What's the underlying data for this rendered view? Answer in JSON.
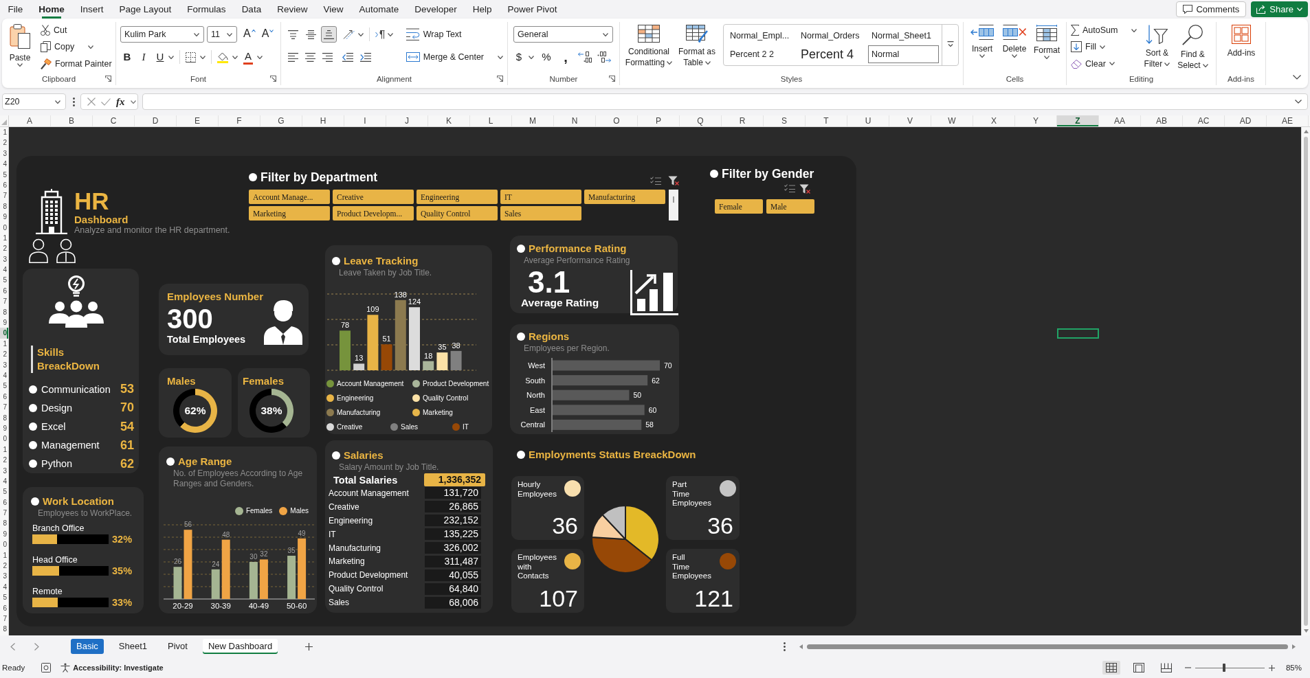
{
  "menu_tabs": [
    {
      "label": "File",
      "selected": false
    },
    {
      "label": "Home",
      "selected": true
    },
    {
      "label": "Insert",
      "selected": false
    },
    {
      "label": "Page Layout",
      "selected": false
    },
    {
      "label": "Formulas",
      "selected": false
    },
    {
      "label": "Data",
      "selected": false
    },
    {
      "label": "Review",
      "selected": false
    },
    {
      "label": "View",
      "selected": false
    },
    {
      "label": "Automate",
      "selected": false
    },
    {
      "label": "Developer",
      "selected": false
    },
    {
      "label": "Help",
      "selected": false
    },
    {
      "label": "Power Pivot",
      "selected": false
    }
  ],
  "comments_button": "Comments",
  "share_button": "Share",
  "ribbon": {
    "clipboard": {
      "label": "Clipboard",
      "paste": "Paste",
      "cut": "Cut",
      "copy": "Copy",
      "format_painter": "Format Painter"
    },
    "font": {
      "label": "Font",
      "font_name": "Kulim Park",
      "font_size": "11",
      "grow_font": "A",
      "shrink_font": "A",
      "bold": "B",
      "italic": "I",
      "underline": "U",
      "font_color": "A"
    },
    "alignment": {
      "label": "Alignment",
      "vertical_align": [
        {
          "selected": false
        },
        {
          "selected": false
        },
        {
          "selected": true
        }
      ],
      "wrap_text": "Wrap Text",
      "merge_center": "Merge & Center"
    },
    "number": {
      "label": "Number",
      "format": "General",
      "currency": "$",
      "percent": "%",
      "comma": ","
    },
    "styles": {
      "label": "Styles",
      "conditional_formatting": "Conditional Formatting",
      "format_as_table": "Format as Table",
      "gallery": [
        {
          "label": "Normal_Empl...",
          "kind": "plain",
          "selected": false
        },
        {
          "label": "Normal_Orders",
          "kind": "plain",
          "selected": false
        },
        {
          "label": "Normal_Sheet1",
          "kind": "plain",
          "selected": false
        },
        {
          "label": "Percent 2 2",
          "kind": "plain",
          "selected": false
        },
        {
          "label": "Percent 4",
          "kind": "large",
          "selected": false
        },
        {
          "label": "Normal",
          "kind": "plain",
          "selected": true
        }
      ]
    },
    "cells": {
      "label": "Cells",
      "insert": "Insert",
      "delete": "Delete",
      "format": "Format"
    },
    "editing": {
      "label": "Editing",
      "autosum": "AutoSum",
      "fill": "Fill",
      "clear": "Clear",
      "sort_filter": "Sort & Filter",
      "find_select": "Find & Select"
    },
    "add_ins": {
      "label": "Add-ins",
      "button": "Add-ins"
    }
  },
  "formula_bar": {
    "name_box": "Z20",
    "fx": "fx"
  },
  "column_headers": [
    {
      "label": "A",
      "selected": false
    },
    {
      "label": "B",
      "selected": false
    },
    {
      "label": "C",
      "selected": false
    },
    {
      "label": "D",
      "selected": false
    },
    {
      "label": "E",
      "selected": false
    },
    {
      "label": "F",
      "selected": false
    },
    {
      "label": "G",
      "selected": false
    },
    {
      "label": "H",
      "selected": false
    },
    {
      "label": "I",
      "selected": false
    },
    {
      "label": "J",
      "selected": false
    },
    {
      "label": "K",
      "selected": false
    },
    {
      "label": "L",
      "selected": false
    },
    {
      "label": "M",
      "selected": false
    },
    {
      "label": "N",
      "selected": false
    },
    {
      "label": "O",
      "selected": false
    },
    {
      "label": "P",
      "selected": false
    },
    {
      "label": "Q",
      "selected": false
    },
    {
      "label": "R",
      "selected": false
    },
    {
      "label": "S",
      "selected": false
    },
    {
      "label": "T",
      "selected": false
    },
    {
      "label": "U",
      "selected": false
    },
    {
      "label": "V",
      "selected": false
    },
    {
      "label": "W",
      "selected": false
    },
    {
      "label": "X",
      "selected": false
    },
    {
      "label": "Y",
      "selected": false
    },
    {
      "label": "Z",
      "selected": true
    },
    {
      "label": "AA",
      "selected": false
    },
    {
      "label": "AB",
      "selected": false
    },
    {
      "label": "AC",
      "selected": false
    },
    {
      "label": "AD",
      "selected": false
    },
    {
      "label": "AE",
      "selected": false
    }
  ],
  "row_headers": [
    {
      "label": "1",
      "selected": false
    },
    {
      "label": "2",
      "selected": false
    },
    {
      "label": "3",
      "selected": false
    },
    {
      "label": "4",
      "selected": false
    },
    {
      "label": "5",
      "selected": false
    },
    {
      "label": "6",
      "selected": false
    },
    {
      "label": "7",
      "selected": false
    },
    {
      "label": "8",
      "selected": false
    },
    {
      "label": "9",
      "selected": false
    },
    {
      "label": "0",
      "selected": false
    },
    {
      "label": "1",
      "selected": false
    },
    {
      "label": "2",
      "selected": false
    },
    {
      "label": "3",
      "selected": false
    },
    {
      "label": "4",
      "selected": false
    },
    {
      "label": "5",
      "selected": false
    },
    {
      "label": "6",
      "selected": false
    },
    {
      "label": "7",
      "selected": false
    },
    {
      "label": "8",
      "selected": false
    },
    {
      "label": "9",
      "selected": false
    },
    {
      "label": "0",
      "selected": true
    },
    {
      "label": "1",
      "selected": false
    },
    {
      "label": "2",
      "selected": false
    },
    {
      "label": "3",
      "selected": false
    },
    {
      "label": "4",
      "selected": false
    },
    {
      "label": "5",
      "selected": false
    },
    {
      "label": "6",
      "selected": false
    },
    {
      "label": "7",
      "selected": false
    },
    {
      "label": "8",
      "selected": false
    },
    {
      "label": "9",
      "selected": false
    },
    {
      "label": "0",
      "selected": false
    },
    {
      "label": "1",
      "selected": false
    },
    {
      "label": "2",
      "selected": false
    },
    {
      "label": "3",
      "selected": false
    },
    {
      "label": "4",
      "selected": false
    },
    {
      "label": "5",
      "selected": false
    },
    {
      "label": "6",
      "selected": false
    },
    {
      "label": "7",
      "selected": false
    },
    {
      "label": "8",
      "selected": false
    },
    {
      "label": "9",
      "selected": false
    },
    {
      "label": "0",
      "selected": false
    },
    {
      "label": "1",
      "selected": false
    },
    {
      "label": "2",
      "selected": false
    },
    {
      "label": "3",
      "selected": false
    },
    {
      "label": "4",
      "selected": false
    },
    {
      "label": "5",
      "selected": false
    },
    {
      "label": "6",
      "selected": false
    },
    {
      "label": "7",
      "selected": false
    },
    {
      "label": "8",
      "selected": false
    }
  ],
  "dashboard": {
    "header": {
      "title": "HR",
      "subtitle": "Dashboard",
      "description": "Analyze and monitor the HR department."
    },
    "department_filter": {
      "title": "Filter by Department",
      "items": [
        {
          "label": "Account Manage...",
          "selected": true
        },
        {
          "label": "Creative",
          "selected": true
        },
        {
          "label": "Engineering",
          "selected": true
        },
        {
          "label": "IT",
          "selected": true
        },
        {
          "label": "Manufacturing",
          "selected": true
        },
        {
          "label": "Marketing",
          "selected": true
        },
        {
          "label": "Product Developm...",
          "selected": true
        },
        {
          "label": "Quality Control",
          "selected": true
        },
        {
          "label": "Sales",
          "selected": true
        }
      ]
    },
    "gender_filter": {
      "title": "Filter by Gender",
      "items": [
        {
          "label": "Female",
          "selected": true
        },
        {
          "label": "Male",
          "selected": true
        }
      ]
    },
    "skills": {
      "title": "Skills BreackDown",
      "items": [
        {
          "label": "Communication",
          "value": "53"
        },
        {
          "label": "Design",
          "value": "70"
        },
        {
          "label": "Excel",
          "value": "54"
        },
        {
          "label": "Management",
          "value": "61"
        },
        {
          "label": "Python",
          "value": "62"
        }
      ]
    },
    "work_location": {
      "title": "Work Location",
      "subtitle": "Employees to WorkPlace.",
      "items": [
        {
          "label": "Branch Office",
          "level": 0.32,
          "reading": "32%"
        },
        {
          "label": "Head Office",
          "level": 0.35,
          "reading": "35%"
        },
        {
          "label": "Remote",
          "level": 0.33,
          "reading": "33%"
        }
      ]
    },
    "employees_number": {
      "title": "Employees Number",
      "value": "300",
      "caption": "Total Employees"
    },
    "gender_split": [
      {
        "title": "Males",
        "reading": "62%",
        "chart_data": {
          "type": "donut",
          "values": [
            62,
            38
          ],
          "colors": [
            "#e8b446",
            "#000000"
          ]
        }
      },
      {
        "title": "Females",
        "reading": "38%",
        "chart_data": {
          "type": "donut",
          "values": [
            38,
            62
          ],
          "colors": [
            "#a5b592",
            "#000000"
          ]
        }
      }
    ],
    "age_range": {
      "title": "Age Range",
      "subtitle": "No. of Employees According to Age Ranges and Genders.",
      "chart_data": {
        "type": "bar",
        "categories": [
          "20-29",
          "30-39",
          "40-49",
          "50-60"
        ],
        "series": [
          {
            "name": "Females",
            "color": "#a5b592",
            "values": [
              26,
              24,
              30,
              35
            ]
          },
          {
            "name": "Males",
            "color": "#f0a445",
            "values": [
              56,
              48,
              32,
              49
            ]
          }
        ],
        "ylim": [
          0,
          60
        ],
        "yticks": [
          0,
          10,
          20,
          30,
          40,
          50,
          60
        ],
        "tick_labels": "x",
        "grid": true,
        "data_labels": true
      }
    },
    "leave_tracking": {
      "title": "Leave Tracking",
      "subtitle": "Leave Taken by Job Title.",
      "chart_data": {
        "type": "bar",
        "categories": [
          null,
          null,
          null,
          null,
          null,
          null,
          null,
          null,
          null
        ],
        "values": [
          78,
          13,
          109,
          51,
          138,
          124,
          18,
          35,
          38
        ],
        "colors": [
          "#76933c",
          "#d0d0d0",
          "#e8b446",
          "#974806",
          "#8c7a4f",
          "#dcdcdc",
          "#a9b59a",
          "#fbe1a6",
          "#808080"
        ],
        "ylim": [
          0,
          150
        ],
        "ref_lines": [
          {
            "axis": "y",
            "value": 0,
            "color": "#9c8550",
            "line_style": "dashed"
          },
          {
            "axis": "y",
            "value": 50,
            "color": "#9c8550",
            "line_style": "dashed"
          },
          {
            "axis": "y",
            "value": 100,
            "color": "#9c8550",
            "line_style": "dashed"
          },
          {
            "axis": "y",
            "value": 150,
            "color": "#9c8550",
            "line_style": "dashed"
          }
        ],
        "data_labels": true
      },
      "legend": [
        {
          "label": "Account Management",
          "color": "#76933c"
        },
        {
          "label": "Product Development",
          "color": "#a9b59a"
        },
        {
          "label": "Engineering",
          "color": "#e8b446"
        },
        {
          "label": "Quality Control",
          "color": "#fbe1a6"
        },
        {
          "label": "Manufacturing",
          "color": "#8c7a4f"
        },
        {
          "label": "Marketing",
          "color": "#e6b54a"
        },
        {
          "label": "Creative",
          "color": "#d9d9d9"
        },
        {
          "label": "Sales",
          "color": "#7f7f7f"
        },
        {
          "label": "IT",
          "color": "#974806"
        }
      ]
    },
    "salaries": {
      "title": "Salaries",
      "subtitle": "Salary Amount by Job Title.",
      "total_label": "Total Salaries",
      "total_value": "1,336,352",
      "rows": [
        {
          "label": "Account Management",
          "value": "131,720"
        },
        {
          "label": "Creative",
          "value": "26,865"
        },
        {
          "label": "Engineering",
          "value": "232,152"
        },
        {
          "label": "IT",
          "value": "135,225"
        },
        {
          "label": "Manufacturing",
          "value": "326,002"
        },
        {
          "label": "Marketing",
          "value": "311,487"
        },
        {
          "label": "Product Development",
          "value": "40,055"
        },
        {
          "label": "Quality Control",
          "value": "64,840"
        },
        {
          "label": "Sales",
          "value": "68,006"
        }
      ]
    },
    "performance": {
      "title": "Performance Rating",
      "subtitle": "Average Performance Rating",
      "value": "3.1",
      "caption": "Average Rating"
    },
    "regions": {
      "title": "Regions",
      "subtitle": "Employees per Region.",
      "chart_data": {
        "type": "bar",
        "orientation": "horizontal",
        "categories": [
          "West",
          "South",
          "North",
          "East",
          "Central"
        ],
        "values": [
          70,
          62,
          50,
          60,
          58
        ],
        "color": "#595959",
        "tick_labels": "y",
        "data_labels": true
      }
    },
    "employment_status": {
      "title": "Employments Status BreackDown",
      "cards": [
        {
          "label": "Hourly Employees",
          "value": "36",
          "color": "#f8dfae"
        },
        {
          "label": "Part Time Employees",
          "value": "36",
          "color": "#c4c4c4"
        },
        {
          "label": "Employees with Contacts",
          "value": "107",
          "color": "#e8b446"
        },
        {
          "label": "Full Time Employees",
          "value": "121",
          "color": "#974806"
        }
      ],
      "chart_data": {
        "type": "pie",
        "categories": [
          null,
          null,
          null,
          null
        ],
        "values": [
          35.67,
          40.33,
          12,
          12
        ],
        "colors": [
          "#e3b928",
          "#974806",
          "#f8cfa0",
          "#c0c0c0"
        ]
      }
    }
  },
  "sheet_tabs": [
    {
      "label": "Basic",
      "selected": false,
      "color": "#1f6fc5"
    },
    {
      "label": "Sheet1",
      "selected": false
    },
    {
      "label": "Pivot",
      "selected": false
    },
    {
      "label": "New Dashboard",
      "selected": true
    }
  ],
  "status_bar": {
    "status": "Ready",
    "accessibility": "Accessibility: Investigate",
    "views": [
      {
        "selected": true
      },
      {
        "selected": false
      },
      {
        "selected": false
      }
    ],
    "zoom_slider": {
      "level": 0.42
    },
    "zoom": "85%"
  }
}
